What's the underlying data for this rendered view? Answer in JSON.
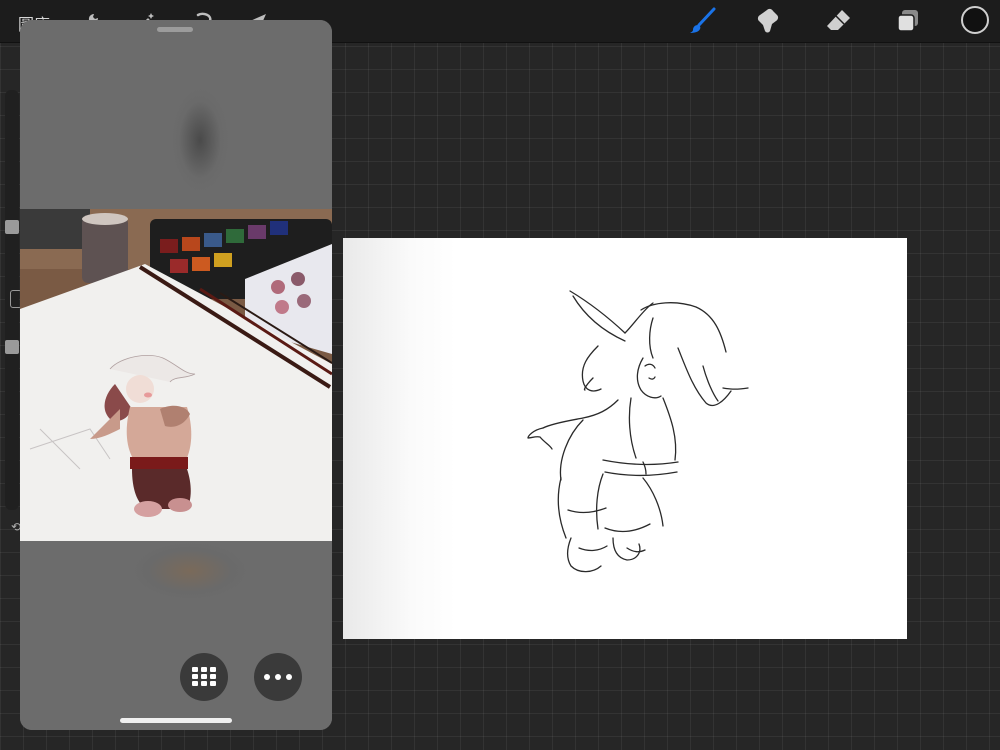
{
  "topbar": {
    "gallery_label": "圖庫",
    "left_tools": [
      "wrench-icon",
      "magic-wand-icon",
      "selection-icon",
      "transform-arrow-icon"
    ],
    "right_tools": [
      {
        "name": "brush-icon",
        "active": true
      },
      {
        "name": "smudge-icon",
        "active": false
      },
      {
        "name": "eraser-icon",
        "active": false
      },
      {
        "name": "layers-icon",
        "active": false
      }
    ],
    "color_swatch": "#111111",
    "accent_color": "#1a73e8"
  },
  "reference_panel": {
    "buttons": [
      "grid-icon",
      "more-options-icon"
    ]
  }
}
